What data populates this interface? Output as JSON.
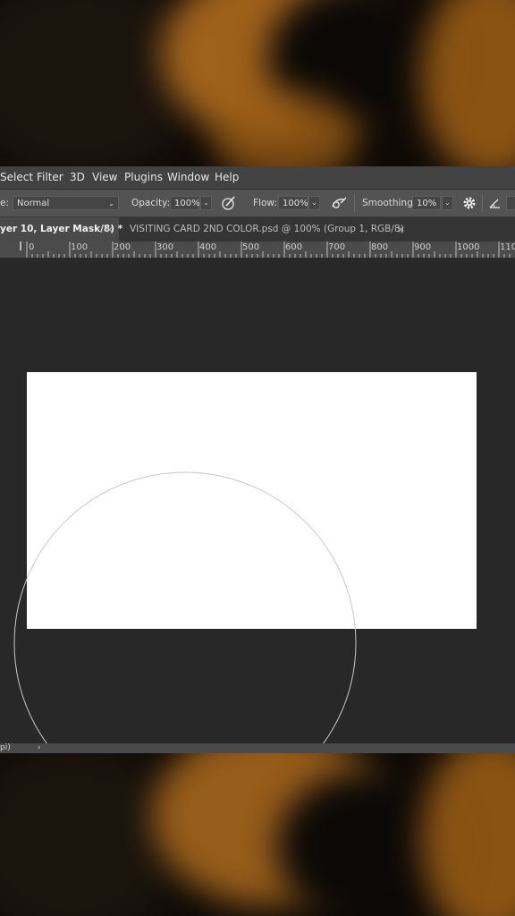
{
  "menubar": {
    "items": [
      "Select",
      "Filter",
      "3D",
      "View",
      "Plugins",
      "Window",
      "Help"
    ]
  },
  "options": {
    "mode_label": "e:",
    "mode_value": "Normal",
    "opacity_label": "Opacity:",
    "opacity_value": "100%",
    "flow_label": "Flow:",
    "flow_value": "100%",
    "smoothing_label": "Smoothing:",
    "smoothing_value": "10%",
    "icons": [
      "airbrush-pressure-icon",
      "airbrush-icon",
      "settings-gear-icon",
      "angle-icon"
    ]
  },
  "tabs": [
    {
      "label": "yer 10, Layer Mask/8) *",
      "active": true,
      "close": "×"
    },
    {
      "label": "VISITING CARD 2ND COLOR.psd @ 100% (Group 1, RGB/8)",
      "active": false,
      "close": "×"
    }
  ],
  "ruler": {
    "labels": [
      "0",
      "100",
      "200",
      "300",
      "400",
      "500",
      "600",
      "700",
      "800",
      "900",
      "1000",
      "110"
    ]
  },
  "status": {
    "text": "pi)"
  },
  "colors": {
    "workspace": "#282828",
    "canvas": "#ffffff",
    "brush_outline": "#d0d0d0",
    "backdrop_accent": "#c0751f"
  }
}
